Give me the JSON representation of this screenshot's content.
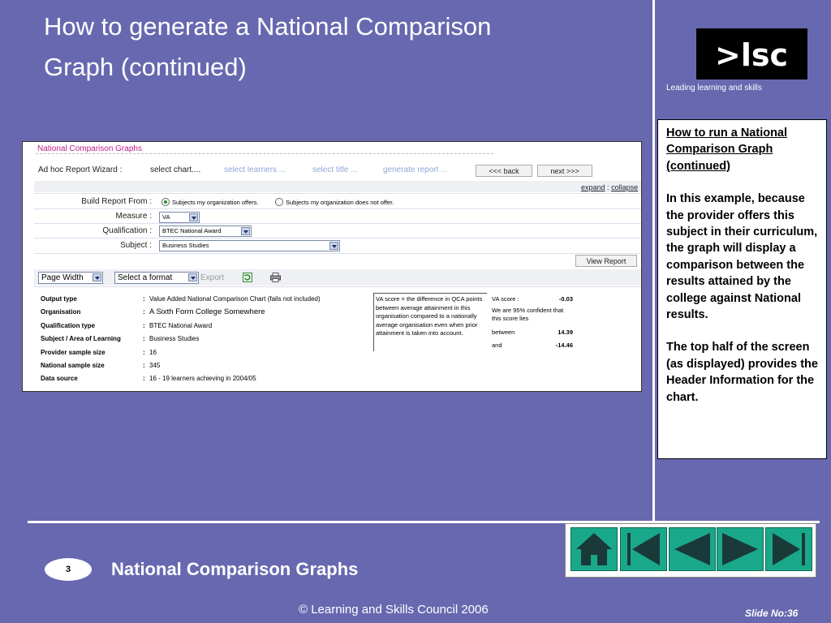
{
  "slide": {
    "title_line1": "How to generate a National Comparison",
    "title_line2": "Graph (continued)",
    "logo_text": ">lsc",
    "tagline": "Leading learning and skills",
    "footer_title": "National Comparison Graphs",
    "page_number": "3",
    "copyright": "© Learning and Skills Council 2006",
    "slide_no": "Slide No:36"
  },
  "note": {
    "title": "How to run a National Comparison Graph (continued)",
    "p1": "In this example, because the provider offers this subject in their curriculum, the graph will display a comparison between the results attained by the college against National results.",
    "p2": "The top half of the screen (as displayed) provides the Header Information for the chart."
  },
  "screenshot": {
    "header": "National Comparison Graphs",
    "wizard": {
      "label": "Ad hoc Report Wizard :",
      "steps": [
        "select chart....",
        "select learners ...",
        "select title ...",
        "generate report ..."
      ],
      "back": "<<< back",
      "next": "next >>>"
    },
    "expand": "expand",
    "sep": ":",
    "collapse": "collapse",
    "form": {
      "build_label": "Build Report From :",
      "radio1": "Subjects my organization offers.",
      "radio2": "Subjects my organization does not offer.",
      "measure_label": "Measure :",
      "measure_value": "VA",
      "qualification_label": "Qualification :",
      "qualification_value": "BTEC National Award",
      "subject_label": "Subject :",
      "subject_value": "Business Studies",
      "view_report": "View Report"
    },
    "toolbar": {
      "page_width": "Page Width",
      "select_format": "Select a format",
      "export": "Export"
    },
    "details": {
      "rows": [
        {
          "key": "Output type",
          "value": "Value Added National Comparison Chart (fails not included)"
        },
        {
          "key": "Organisation",
          "value": "A Sixth Form College Somewhere"
        },
        {
          "key": "Qualification type",
          "value": "BTEC National Award"
        },
        {
          "key": "Subject / Area of Learning",
          "value": "Business Studies"
        },
        {
          "key": "Provider sample size",
          "value": "16"
        },
        {
          "key": "National sample size",
          "value": "345"
        },
        {
          "key": "Data source",
          "value": "16 - 19 learners achieving in 2004/05"
        }
      ],
      "colon": ":",
      "va_explain": "VA score = the difference in QCA points between average attainment in this organisation compared to a nationally average organisation even when prior attainment is taken into account.",
      "va_score_label": "VA score :",
      "va_score_value": "-0.03",
      "confident_text": "We are 95% confident that this score lies",
      "between_label": "between",
      "between_value": "14.39",
      "and_label": "and",
      "and_value": "-14.46"
    }
  },
  "colors": {
    "background": "#6868b0",
    "nav_button": "#1aa88a",
    "header_pink": "#c0208a"
  }
}
